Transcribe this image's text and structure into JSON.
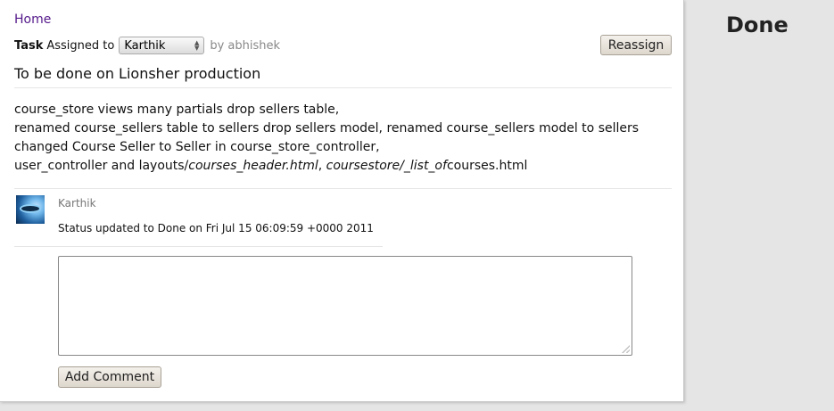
{
  "status_heading": "Done",
  "nav": {
    "home_label": "Home"
  },
  "task": {
    "label": "Task",
    "assigned_to_label": "Assigned to",
    "assignee_selected": "Karthik",
    "by_text": "by abhishek",
    "reassign_label": "Reassign",
    "title": "To be done on Lionsher production"
  },
  "description": {
    "line1": "course_store views many partials drop sellers table,",
    "line2": "renamed course_sellers table to sellers drop sellers model, renamed course_sellers model to sellers",
    "line3": "changed Course Seller to Seller in course_store_controller,",
    "line4_prefix": "user_controller and layouts/",
    "line4_italic1": "courses_header.html",
    "line4_mid": ", ",
    "line4_italic2": "coursestore/_list_of",
    "line4_suffix": "courses.html"
  },
  "comments": [
    {
      "author": "Karthik",
      "avatar": "user-avatar-image",
      "text": "Status updated to Done on Fri Jul 15 06:09:59 +0000 2011"
    }
  ],
  "comment_form": {
    "value": "",
    "submit_label": "Add Comment"
  },
  "icons": {
    "select_arrows": "up-down-arrows-icon",
    "resize_grip": "resize-grip-icon"
  },
  "colors": {
    "link": "#551a8b",
    "page_bg": "#e5e5e5",
    "panel_bg": "#ffffff",
    "muted_text": "#888888"
  }
}
